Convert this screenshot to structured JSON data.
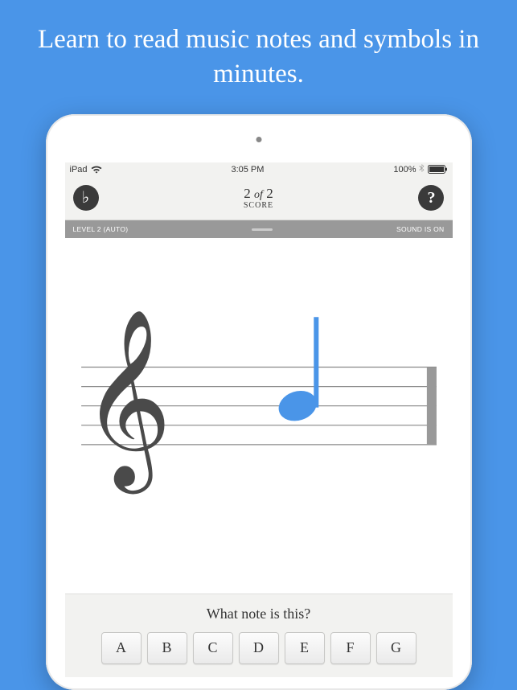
{
  "headline": "Learn to read music notes and symbols in minutes.",
  "status": {
    "device": "iPad",
    "time": "3:05 PM",
    "battery_percent": "100%"
  },
  "header": {
    "score_current": "2",
    "score_of": "of",
    "score_total": "2",
    "score_label": "SCORE"
  },
  "banner": {
    "level": "LEVEL 2 (AUTO)",
    "sound": "SOUND IS ON"
  },
  "question": {
    "prompt": "What note is this?",
    "answers": [
      "A",
      "B",
      "C",
      "D",
      "E",
      "F",
      "G"
    ]
  },
  "note": {
    "clef": "treble",
    "color": "#4a95e8"
  }
}
